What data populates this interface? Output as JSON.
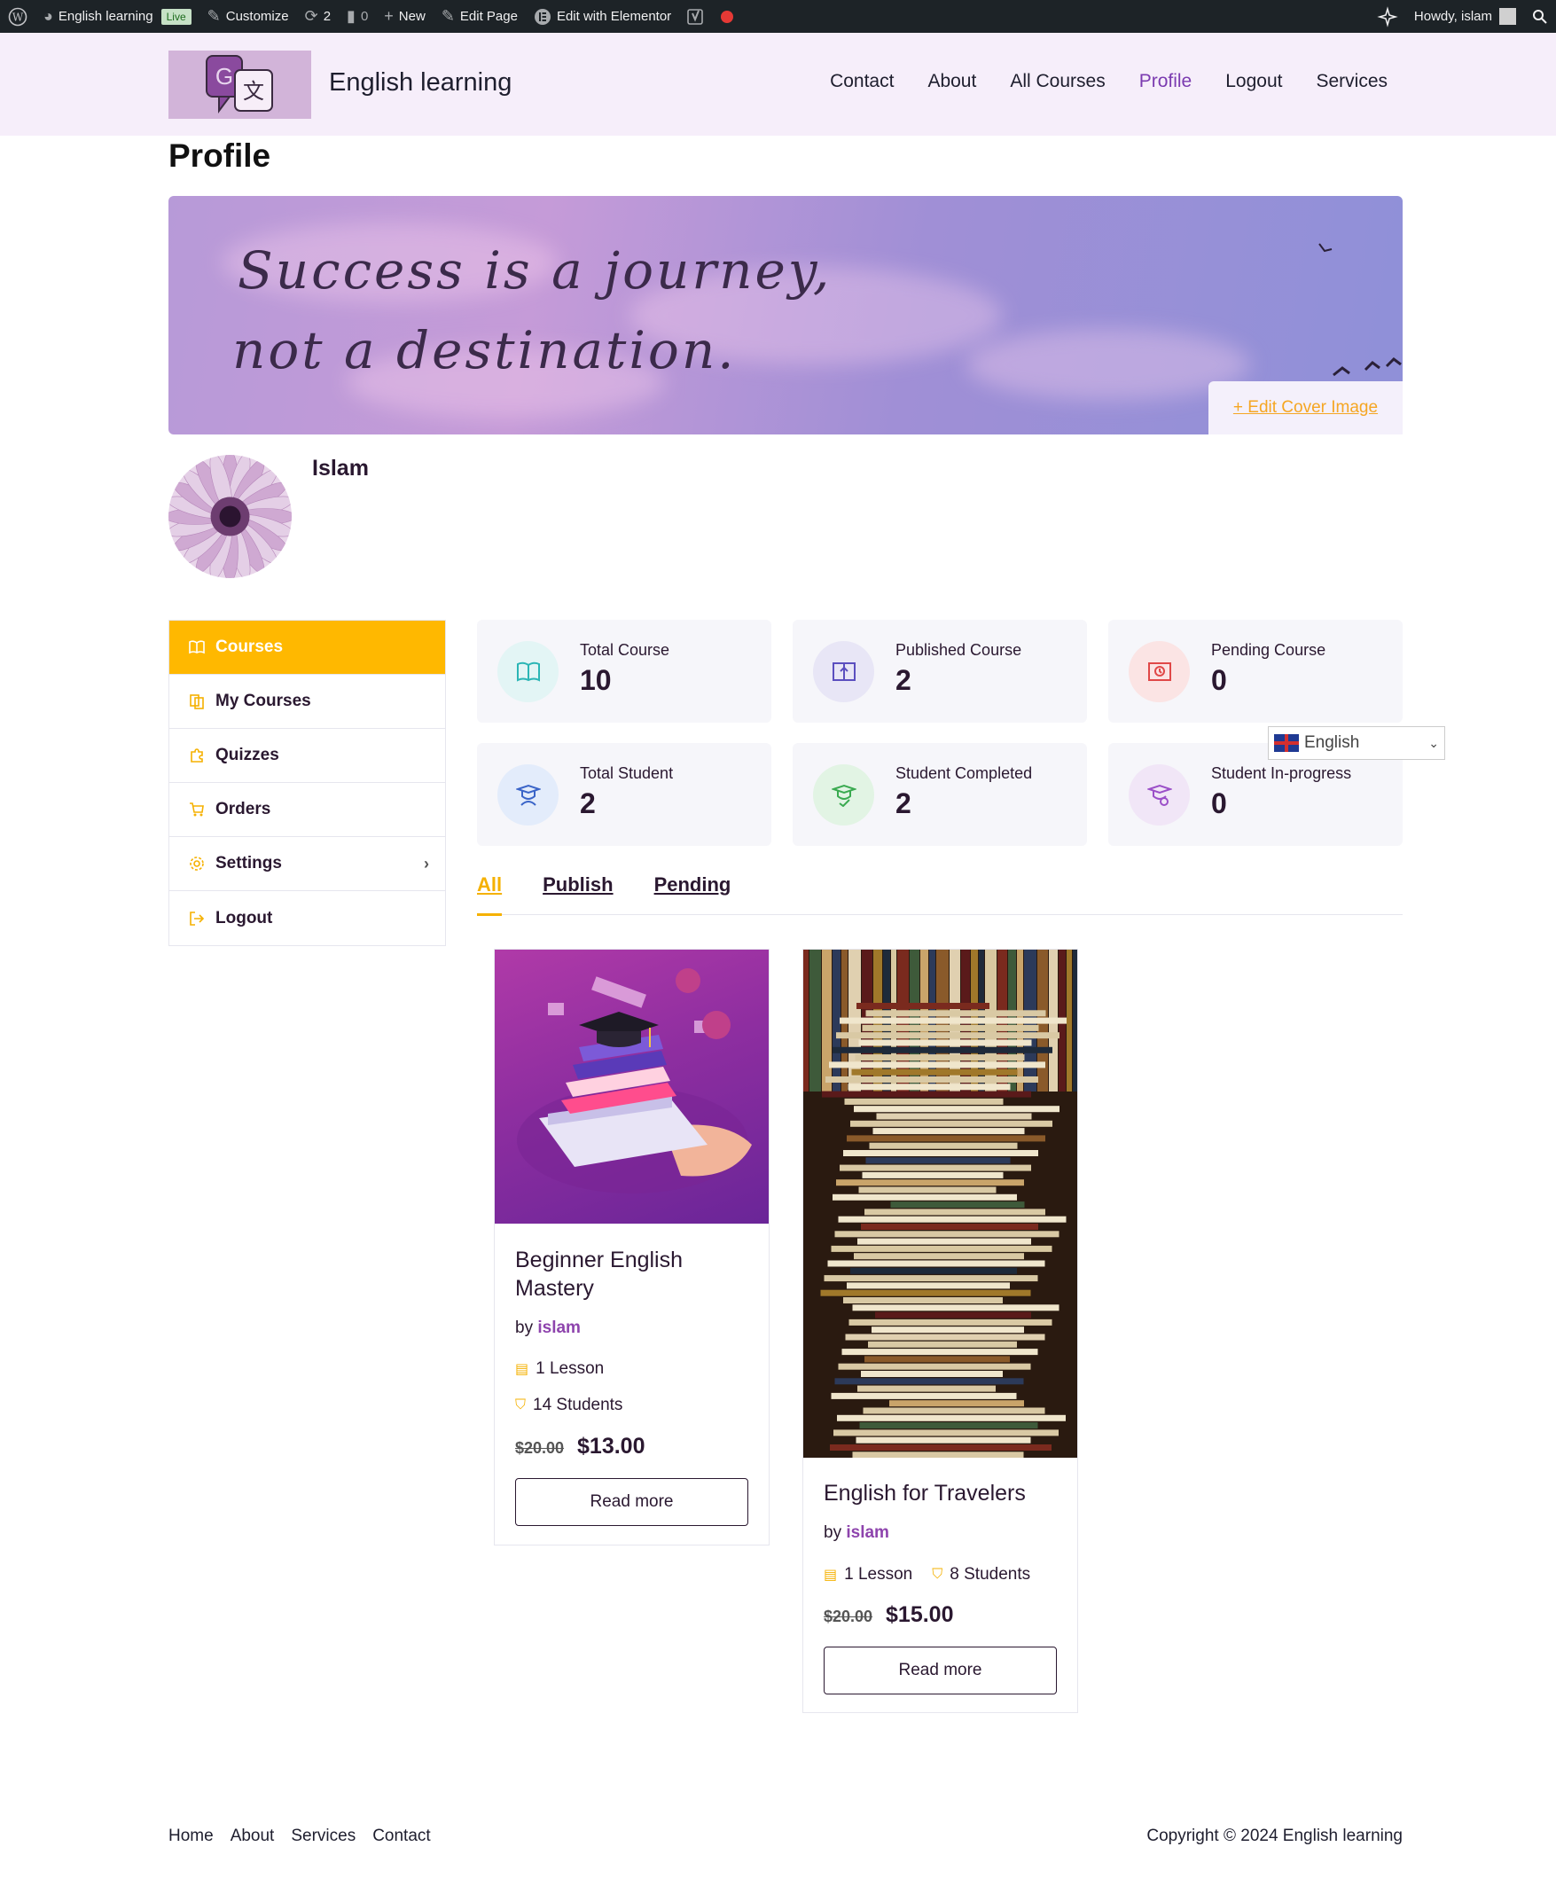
{
  "admin_bar": {
    "site_name": "English learning",
    "live_badge": "Live",
    "customize": "Customize",
    "updates_count": "2",
    "comments_count": "0",
    "new": "New",
    "edit_page": "Edit Page",
    "edit_elementor": "Edit with Elementor",
    "howdy": "Howdy, islam"
  },
  "header": {
    "site_title": "English learning",
    "nav": [
      "Contact",
      "About",
      "All Courses",
      "Profile",
      "Logout",
      "Services"
    ],
    "active_nav": "Profile"
  },
  "page": {
    "title": "Profile",
    "cover_quote_line1": "Success is a journey,",
    "cover_quote_line2": "not a destination.",
    "edit_cover": "+ Edit Cover Image",
    "user_name": "Islam"
  },
  "sidebar": {
    "items": [
      {
        "label": "Courses",
        "icon": "book-open-icon"
      },
      {
        "label": "My Courses",
        "icon": "courses-icon"
      },
      {
        "label": "Quizzes",
        "icon": "puzzle-icon"
      },
      {
        "label": "Orders",
        "icon": "cart-icon"
      },
      {
        "label": "Settings",
        "icon": "gear-icon"
      },
      {
        "label": "Logout",
        "icon": "logout-icon"
      }
    ]
  },
  "stats": [
    {
      "label": "Total Course",
      "value": "10",
      "icon": "book-open-icon",
      "bg": "#e3f5f5",
      "color": "#2bb5b5"
    },
    {
      "label": "Published Course",
      "value": "2",
      "icon": "book-upload-icon",
      "bg": "#e8e6f6",
      "color": "#5b4fbf"
    },
    {
      "label": "Pending Course",
      "value": "0",
      "icon": "book-pending-icon",
      "bg": "#fbe4e4",
      "color": "#e04848"
    },
    {
      "label": "Total Student",
      "value": "2",
      "icon": "student-icon",
      "bg": "#e3ecfb",
      "color": "#3a64c8"
    },
    {
      "label": "Student Completed",
      "value": "2",
      "icon": "student-check-icon",
      "bg": "#e2f4e4",
      "color": "#3aaa50"
    },
    {
      "label": "Student In-progress",
      "value": "0",
      "icon": "student-progress-icon",
      "bg": "#f1e6f7",
      "color": "#9b4fc8"
    }
  ],
  "language": {
    "selected": "English"
  },
  "tabs": [
    "All",
    "Publish",
    "Pending"
  ],
  "active_tab": "All",
  "courses": [
    {
      "title": "Beginner English Mastery",
      "by_label": "by",
      "author": "islam",
      "lessons": "1 Lesson",
      "students": "14 Students",
      "old_price": "$20.00",
      "price": "$13.00",
      "button": "Read more"
    },
    {
      "title": "English for Travelers",
      "by_label": "by",
      "author": "islam",
      "lessons": "1 Lesson",
      "students": "8 Students",
      "old_price": "$20.00",
      "price": "$15.00",
      "button": "Read more"
    }
  ],
  "footer": {
    "nav": [
      "Home",
      "About",
      "Services",
      "Contact"
    ],
    "copyright": "Copyright © 2024 English learning"
  }
}
